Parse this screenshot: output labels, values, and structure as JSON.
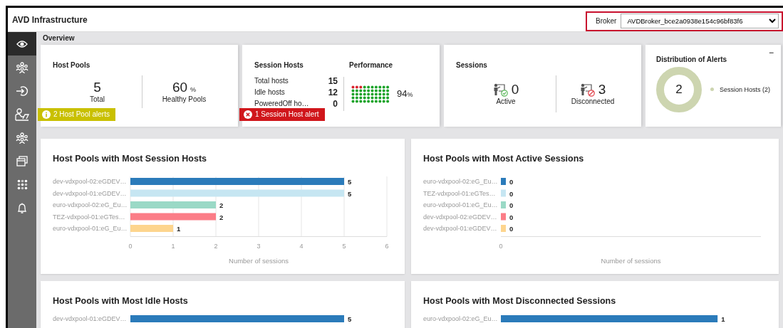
{
  "window": {
    "title": "AVD Infrastructure"
  },
  "broker": {
    "label": "Broker",
    "value": "AVDBroker_bce2a0938e154c96bf83f6"
  },
  "sidebar": {
    "items": [
      {
        "kind": "eye",
        "selected": true
      },
      {
        "kind": "group",
        "selected": false
      },
      {
        "kind": "sign-in",
        "selected": false
      },
      {
        "kind": "desk",
        "selected": false
      },
      {
        "kind": "group",
        "selected": false
      },
      {
        "kind": "windows",
        "selected": false
      },
      {
        "kind": "grid",
        "selected": false
      },
      {
        "kind": "bell",
        "selected": false
      }
    ]
  },
  "section": {
    "title": "Overview"
  },
  "host_pools": {
    "title": "Host Pools",
    "total": {
      "value": "5",
      "label": "Total"
    },
    "healthy": {
      "value": "60",
      "unit": "%",
      "label": "Healthy Pools"
    },
    "alert": {
      "kind": "warning",
      "text": "2 Host Pool alerts"
    }
  },
  "session_hosts": {
    "title": "Session Hosts",
    "rows": [
      {
        "label": "Total hosts",
        "value": "15"
      },
      {
        "label": "Idle hosts",
        "value": "12"
      },
      {
        "label": "PoweredOff ho…",
        "value": "0"
      }
    ],
    "alert": {
      "kind": "error",
      "text": "1 Session Host alert"
    }
  },
  "performance": {
    "title": "Performance",
    "value": "94",
    "unit": "%"
  },
  "sessions": {
    "title": "Sessions",
    "items": [
      {
        "kind": "active",
        "value": "0",
        "label": "Active"
      },
      {
        "kind": "disconnected",
        "value": "3",
        "label": "Disconnected"
      }
    ]
  },
  "alerts_distribution": {
    "title": "Distribution of Alerts",
    "minimize": "−",
    "total": "2",
    "legend": [
      {
        "label": "Session Hosts (2)",
        "color": "#cdd5b0"
      }
    ]
  },
  "charts": [
    {
      "title": "Host Pools with Most Session Hosts",
      "chart_data": {
        "type": "bar",
        "orientation": "horizontal",
        "xlabel": "Number of sessions",
        "categories": [
          "dev-vdxpool-02:eGDEV…",
          "dev-vdxpool-01:eGDEV…",
          "euro-vdxpool-02:eG_Eu…",
          "TEZ-vdxpool-01:eGTes…",
          "euro-vdxpool-01:eG_Eu…"
        ],
        "values": [
          5,
          5,
          2,
          2,
          1
        ],
        "colors": [
          "#2b7bba",
          "#c6e6f2",
          "#9ad9c6",
          "#fb7d87",
          "#fdd58e"
        ],
        "xlim": [
          0,
          6
        ],
        "xticks": [
          0,
          1,
          2,
          3,
          4,
          5,
          6
        ],
        "grid": true,
        "data_labels": true
      }
    },
    {
      "title": "Host Pools with Most Active Sessions",
      "rows": [
        {
          "label": "euro-vdxpool-02:eG_Eu…",
          "value": "0",
          "color": "#2b7bba"
        },
        {
          "label": "TEZ-vdxpool-01:eGTes…",
          "value": "0",
          "color": "#c6e6f2"
        },
        {
          "label": "euro-vdxpool-01:eG_Eu…",
          "value": "0",
          "color": "#9ad9c6"
        },
        {
          "label": "dev-vdxpool-02:eGDEV…",
          "value": "0",
          "color": "#fb7d87"
        },
        {
          "label": "dev-vdxpool-01:eGDEV…",
          "value": "0",
          "color": "#fdd58e"
        }
      ],
      "axis_tick": "0",
      "xlabel": "Number of sessions"
    },
    {
      "title": "Host Pools with Most Idle Hosts",
      "chart_data": {
        "type": "bar",
        "orientation": "horizontal",
        "categories": [
          "dev-vdxpool-01:eGDEV…"
        ],
        "values": [
          5
        ],
        "colors": [
          "#2b7bba"
        ],
        "data_labels": true
      }
    },
    {
      "title": "Host Pools with Most Disconnected Sessions",
      "chart_data": {
        "type": "bar",
        "orientation": "horizontal",
        "categories": [
          "euro-vdxpool-02:eG_Eu…"
        ],
        "values": [
          1
        ],
        "colors": [
          "#2b7bba"
        ],
        "data_labels": true
      }
    }
  ]
}
